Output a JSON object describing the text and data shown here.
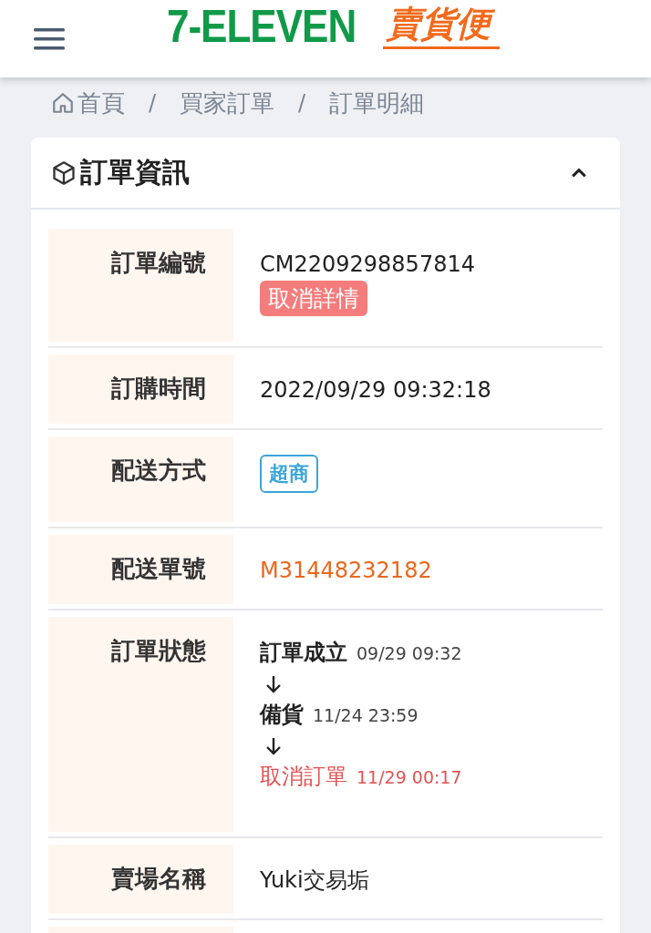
{
  "header": {
    "logo_brand": "7-ELEVEN",
    "logo_service": "賣貨便"
  },
  "breadcrumb": [
    {
      "label": "首頁",
      "kind": "home"
    },
    {
      "label": "買家訂單",
      "kind": "link",
      "separator": "/"
    },
    {
      "label": "訂單明細",
      "kind": "current",
      "separator": "/"
    }
  ],
  "card": {
    "title": "訂單資訊",
    "expanded": true,
    "rows": [
      {
        "label": "訂單編號",
        "kind": "text",
        "value": "CM2209298857814",
        "button": "取消詳情"
      },
      {
        "label": "訂購時間",
        "kind": "text",
        "value": "2022/09/29 09:32:18"
      },
      {
        "label": "配送方式",
        "kind": "tag",
        "value": "超商"
      },
      {
        "label": "配送單號",
        "kind": "link",
        "value": "M31448232182"
      },
      {
        "label": "訂單狀態",
        "kind": "status",
        "steps": [
          {
            "label": "訂單成立",
            "time": "09/29 09:32",
            "cancelled": false
          },
          {
            "label": "備貨",
            "time": "11/24 23:59",
            "cancelled": false
          },
          {
            "label": "取消訂單",
            "time": "11/29 00:17",
            "cancelled": true
          }
        ]
      },
      {
        "label": "賣場名稱",
        "kind": "text",
        "value": "Yuki交易垢"
      },
      {
        "kind": "empty"
      }
    ]
  }
}
